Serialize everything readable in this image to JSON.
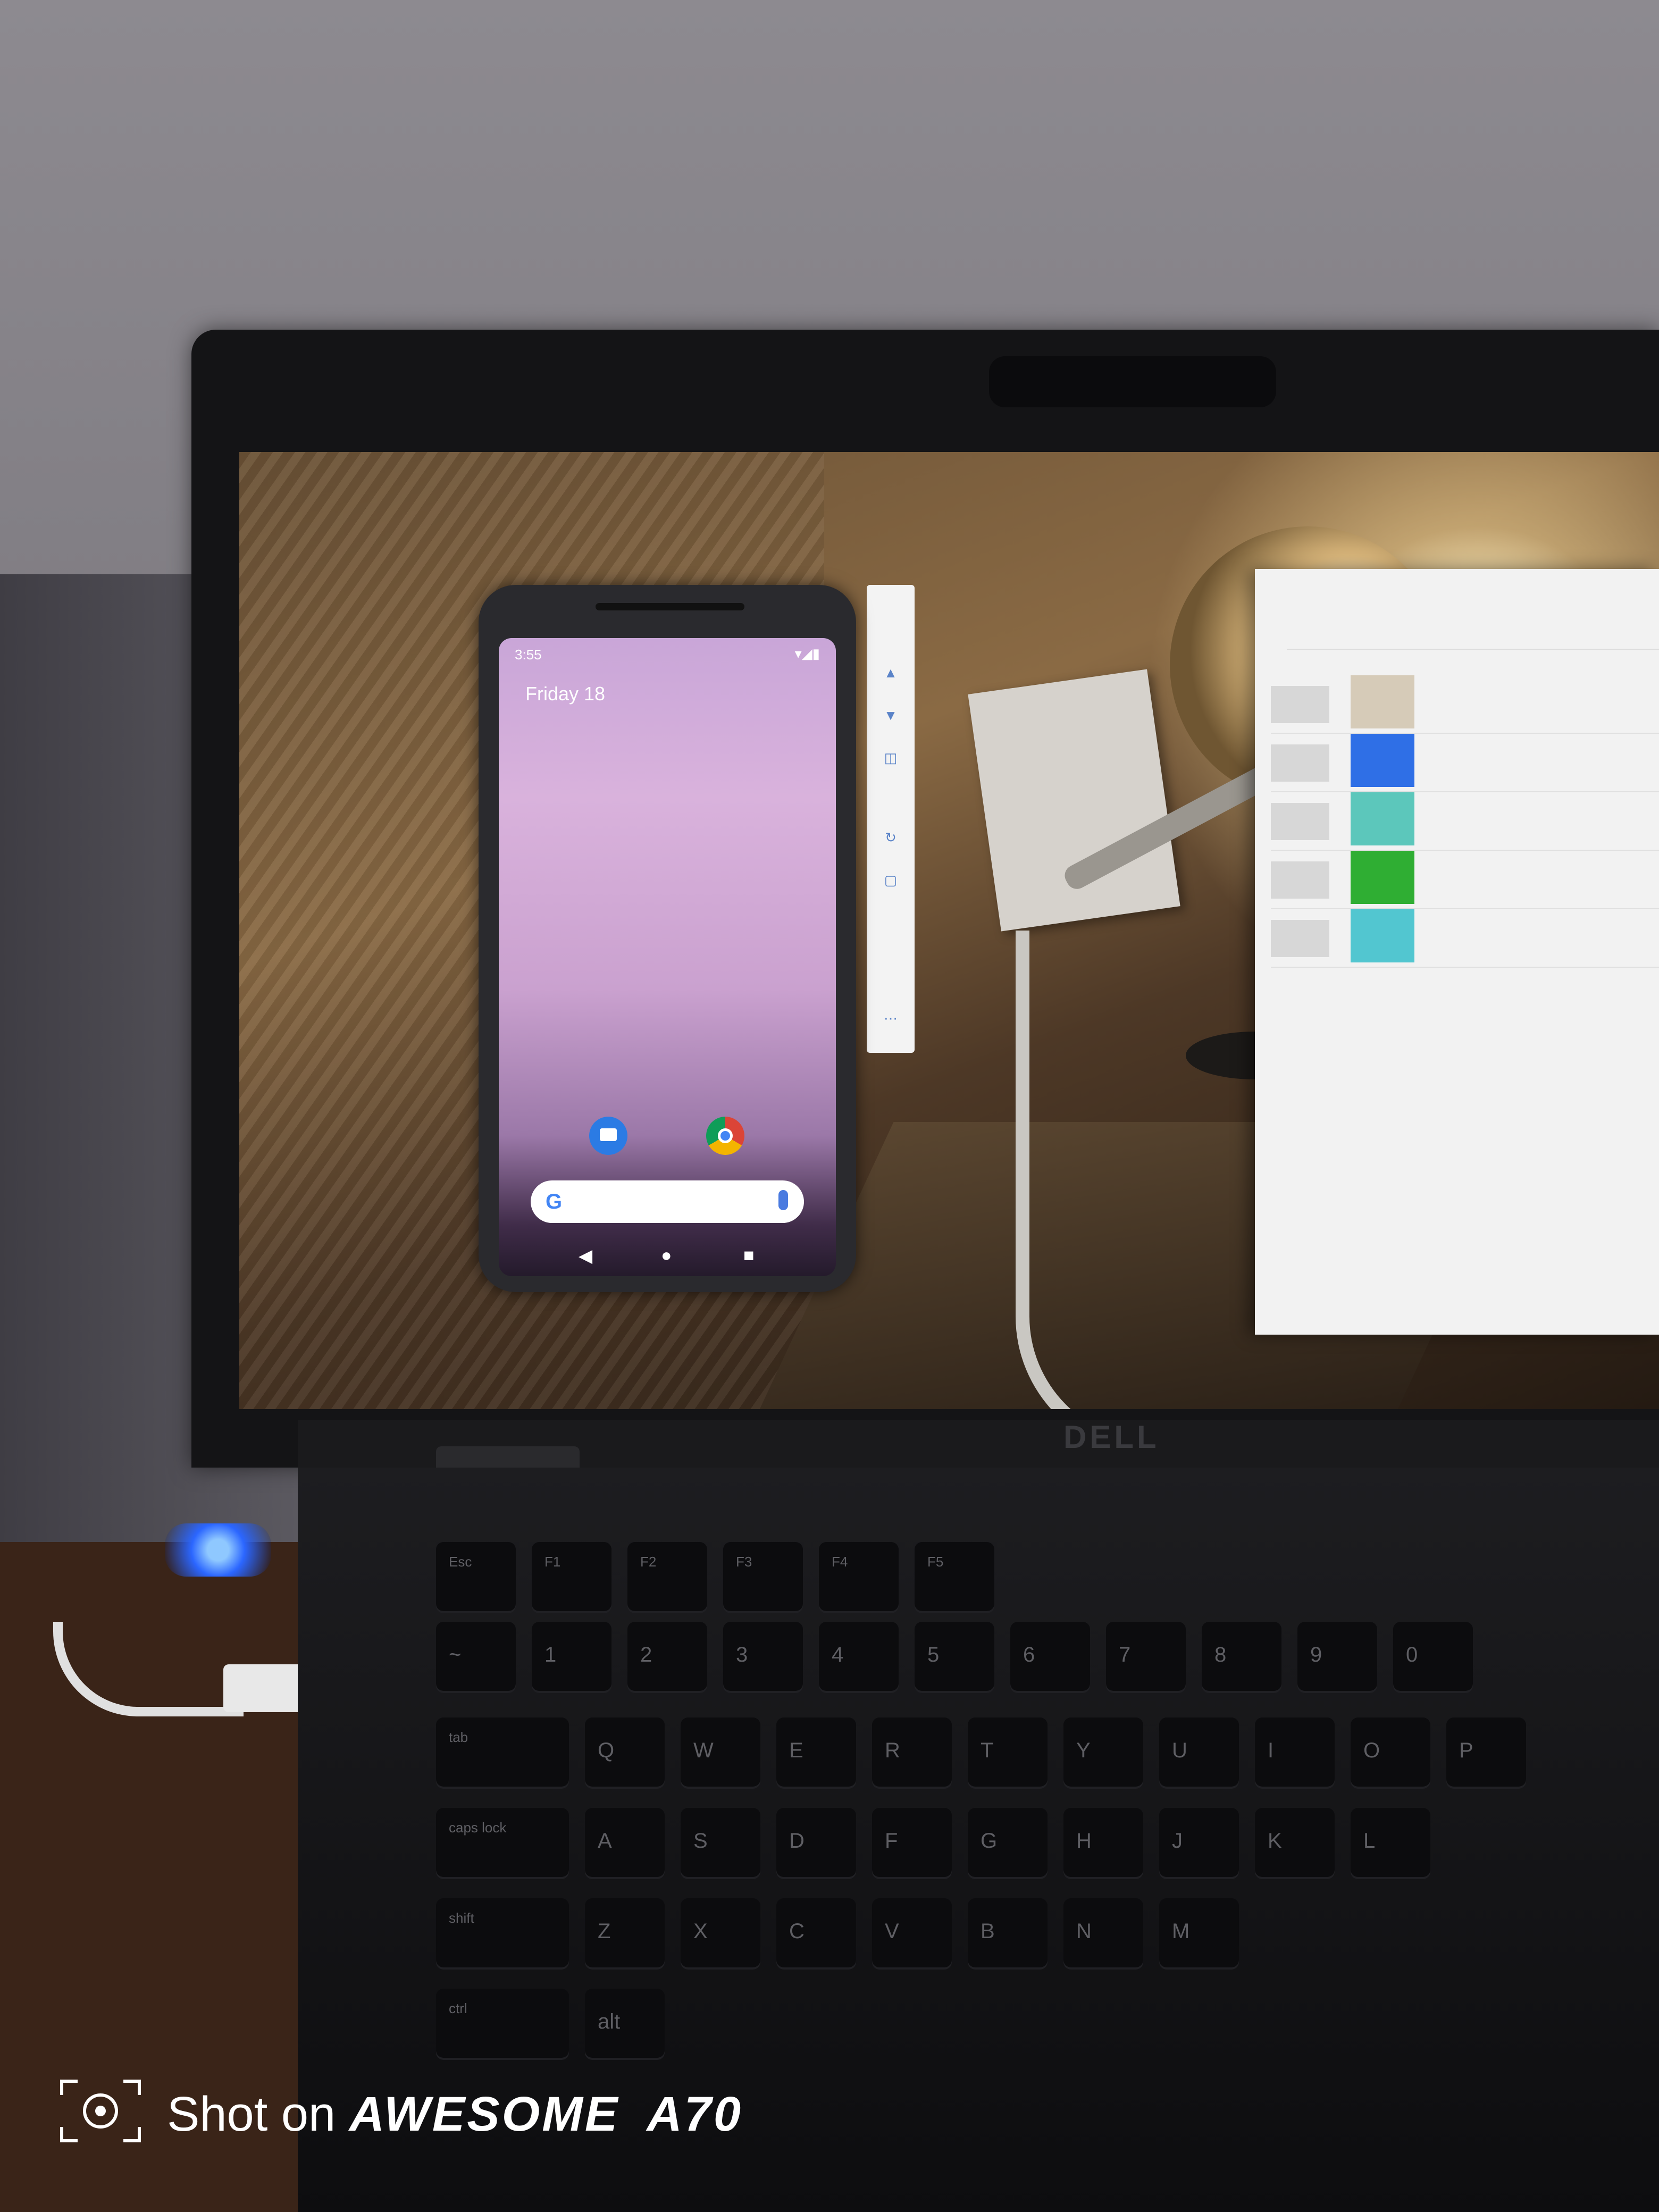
{
  "phone": {
    "status_time": "3:55",
    "date": "Friday 18",
    "nav": {
      "back": "◀",
      "home": "●",
      "recents": "■"
    },
    "search": {
      "logo_letter": "G"
    }
  },
  "panel": {
    "swatches": [
      "#d6cbb8",
      "#2f6fe6",
      "#5cc7bb",
      "#2fae33",
      "#52c6d0"
    ]
  },
  "keyboard": {
    "row1": [
      "Esc",
      "F1",
      "F2",
      "F3",
      "F4",
      "F5"
    ],
    "row2": [
      "~",
      "1",
      "2",
      "3",
      "4",
      "5",
      "6",
      "7",
      "8",
      "9",
      "0"
    ],
    "row3": [
      "tab",
      "Q",
      "W",
      "E",
      "R",
      "T",
      "Y",
      "U",
      "I",
      "O",
      "P"
    ],
    "row4": [
      "caps lock",
      "A",
      "S",
      "D",
      "F",
      "G",
      "H",
      "J",
      "K",
      "L"
    ],
    "row5": [
      "shift",
      "Z",
      "X",
      "C",
      "V",
      "B",
      "N",
      "M"
    ],
    "row6": [
      "ctrl",
      "alt"
    ]
  },
  "laptop": {
    "brand": "DELL"
  },
  "watermark": {
    "prefix": "Shot on ",
    "brand": "AWESOME",
    "model": "A70"
  }
}
